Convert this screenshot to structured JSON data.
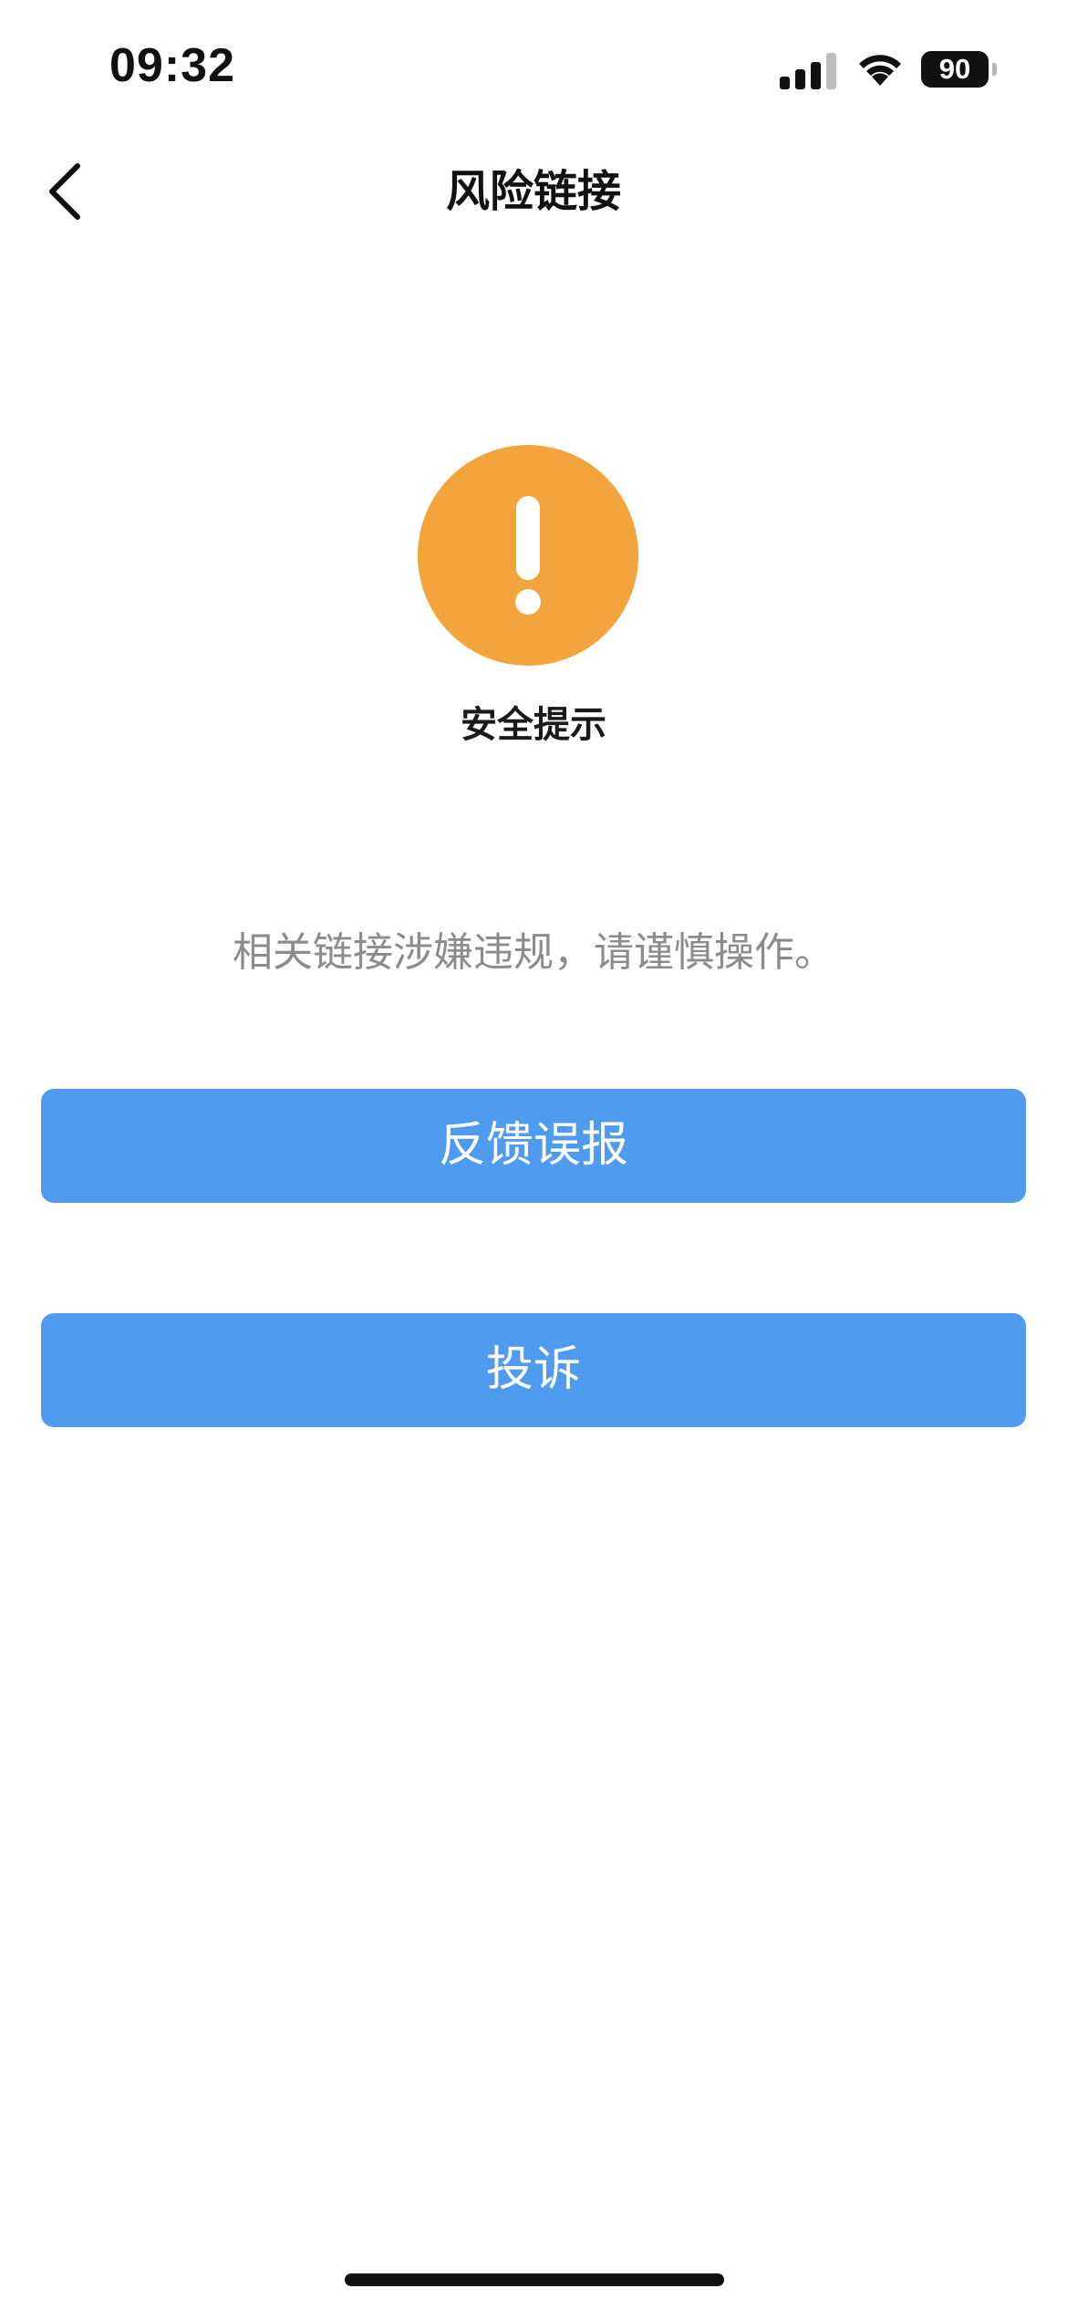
{
  "status_bar": {
    "time": "09:32",
    "battery_level": "90",
    "icons": [
      "signal-icon",
      "wifi-icon",
      "battery-icon"
    ]
  },
  "nav": {
    "back_icon": "chevron-left-icon",
    "title": "风险链接"
  },
  "warning": {
    "icon": "exclamation-warning-icon",
    "icon_color": "#F3A43D",
    "title": "安全提示",
    "message": "相关链接涉嫌违规，请谨慎操作。"
  },
  "actions": {
    "button_color": "#4E9BEF",
    "feedback_label": "反馈误报",
    "complaint_label": "投诉"
  }
}
